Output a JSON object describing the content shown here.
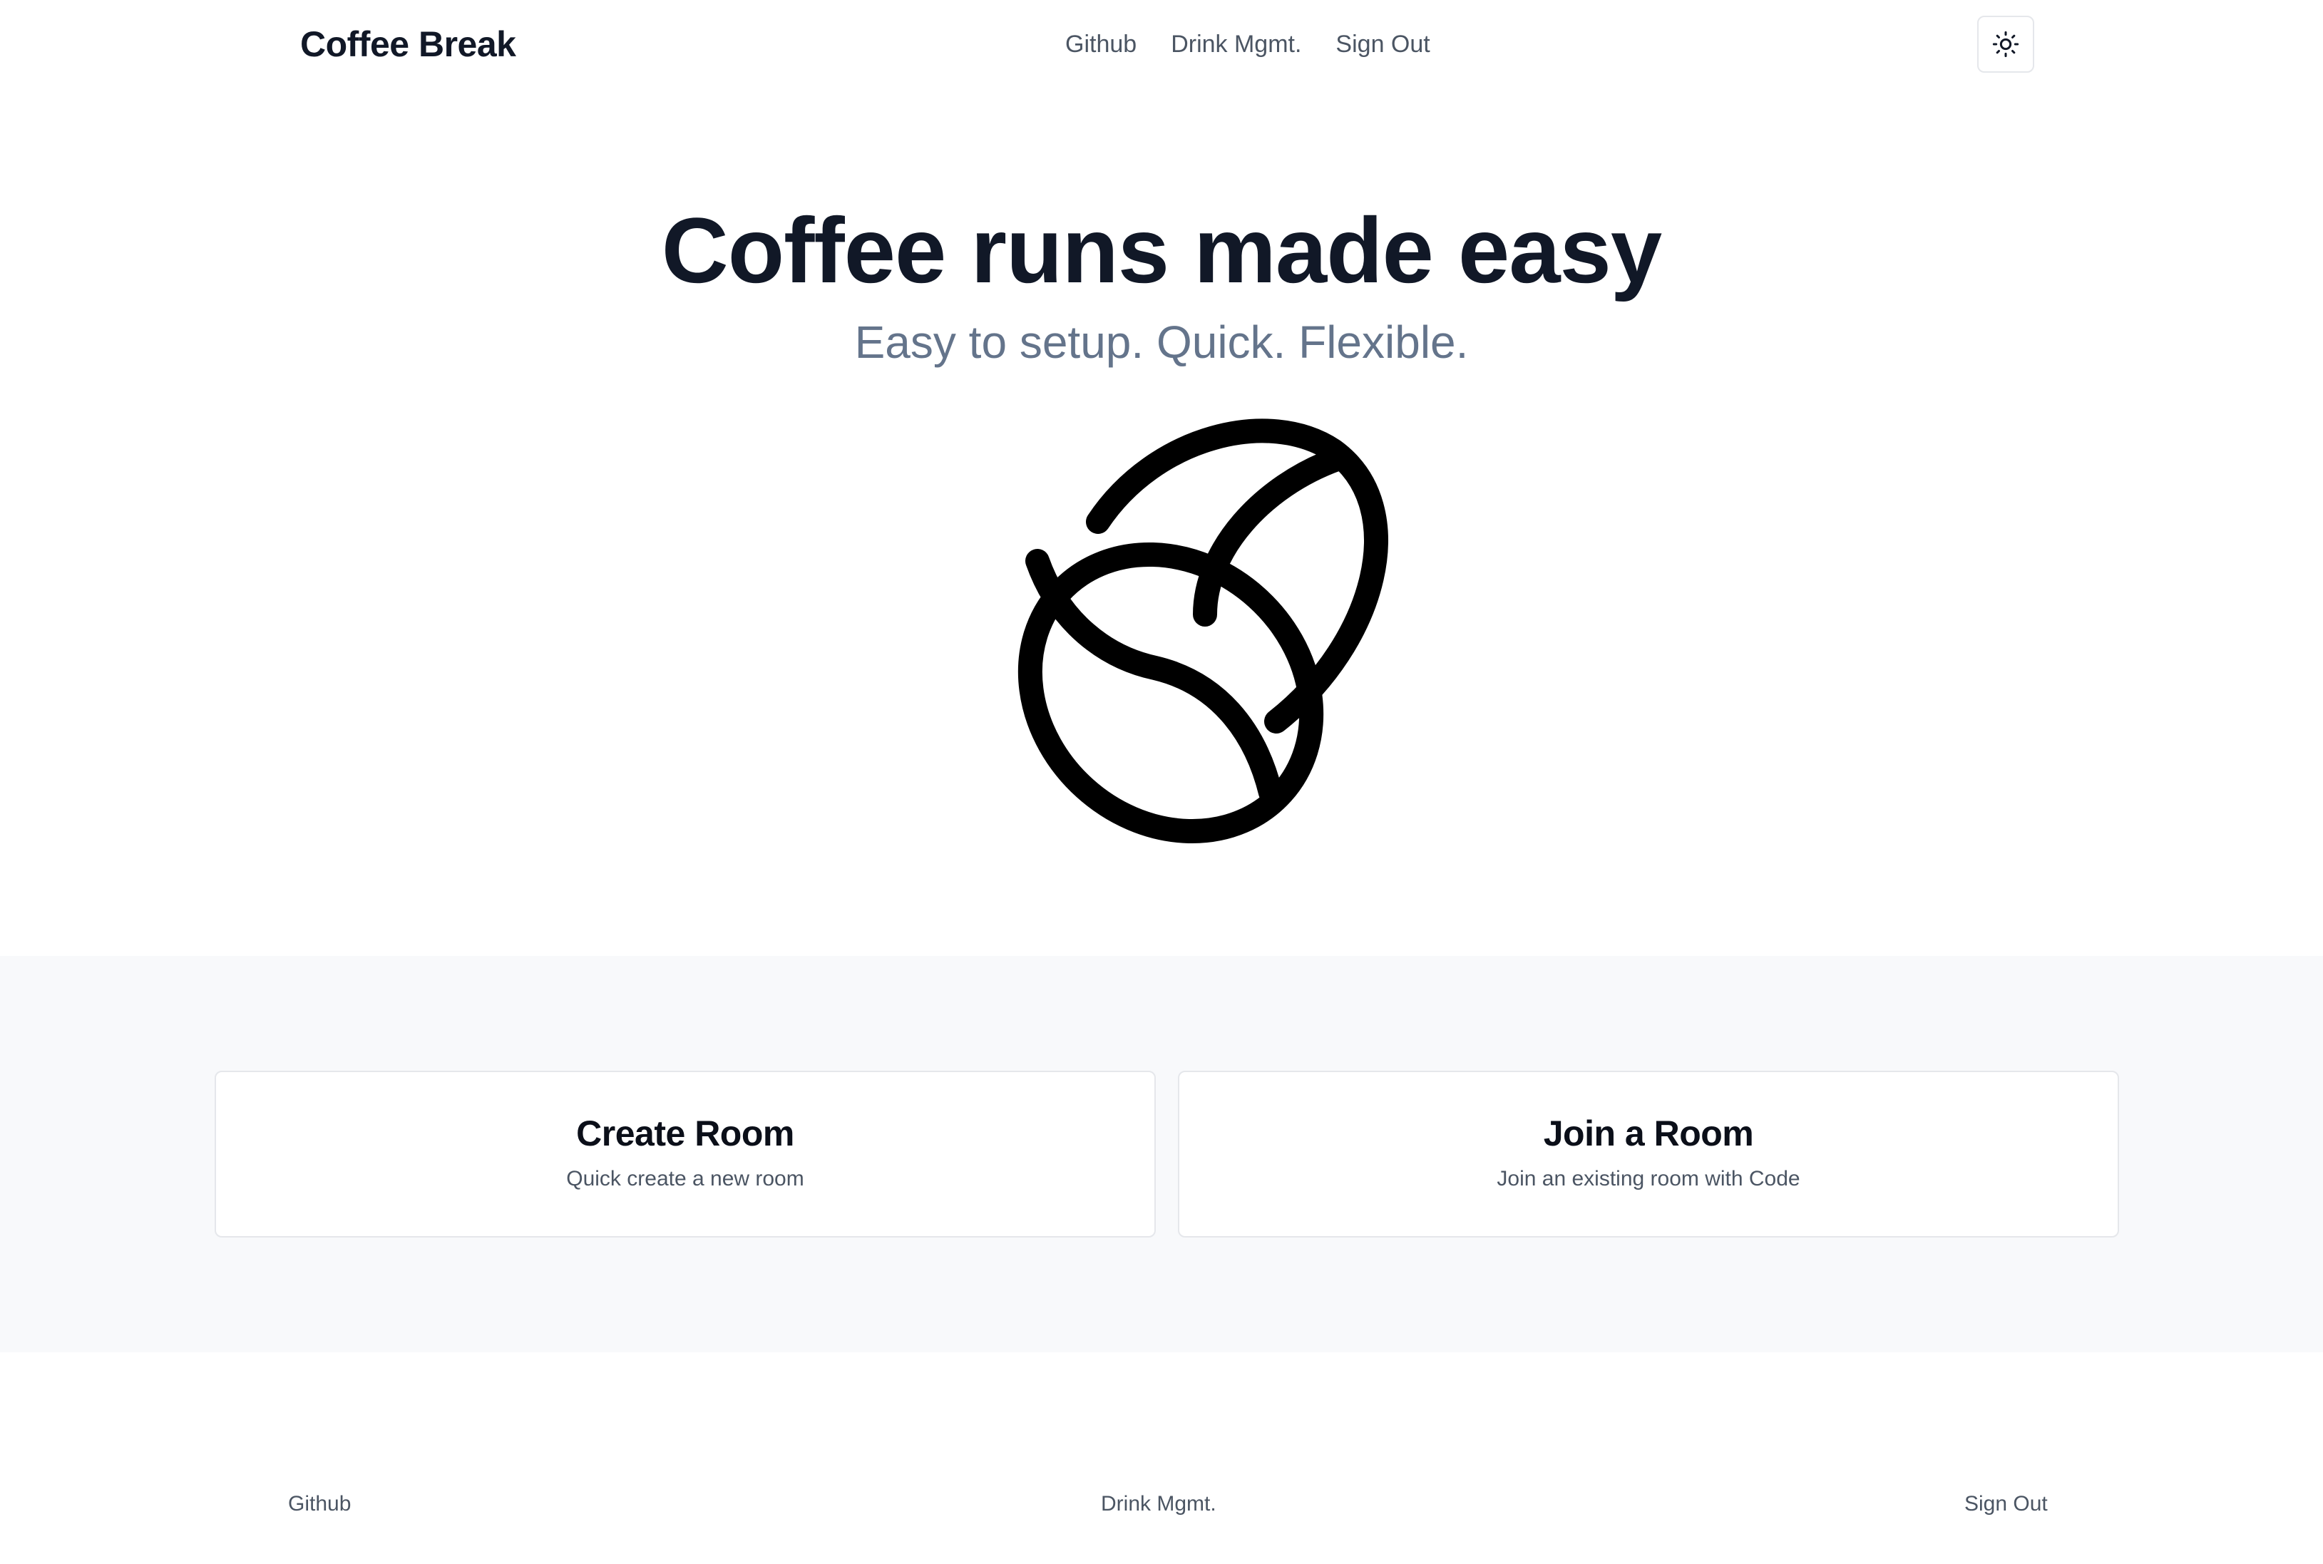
{
  "header": {
    "brand": "Coffee Break",
    "nav": [
      "Github",
      "Drink Mgmt.",
      "Sign Out"
    ],
    "theme_toggle_icon": "sun-icon"
  },
  "hero": {
    "title": "Coffee runs made easy",
    "subtitle": "Easy to setup. Quick. Flexible.",
    "illustration_icon": "coffee-bean-icon"
  },
  "cards": [
    {
      "title": "Create Room",
      "description": "Quick create a new room"
    },
    {
      "title": "Join a Room",
      "description": "Join an existing room with Code"
    }
  ],
  "footer": {
    "links": [
      "Github",
      "Drink Mgmt.",
      "Sign Out"
    ]
  },
  "colors": {
    "text_primary": "#111827",
    "text_muted": "#64748b",
    "band_background": "#f8f9fb",
    "card_border": "#e5e7eb"
  }
}
